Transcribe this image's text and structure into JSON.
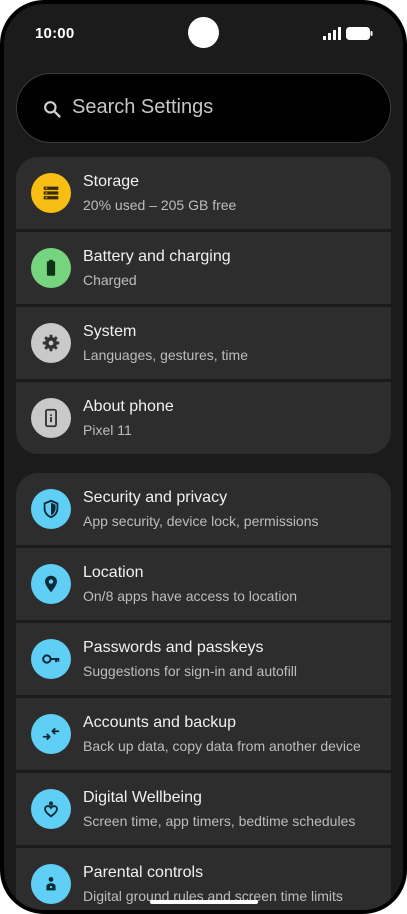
{
  "status_bar": {
    "time": "10:00",
    "icons": [
      "signal-icon",
      "battery-icon"
    ]
  },
  "search": {
    "placeholder": "Search Settings",
    "icon": "search-icon"
  },
  "groups": [
    {
      "items": [
        {
          "title": "Storage",
          "subtitle": "20% used – 205 GB free",
          "icon": "storage-icon",
          "color": "#f9be14"
        },
        {
          "title": "Battery and charging",
          "subtitle": "Charged",
          "icon": "battery-icon",
          "color": "#76d47e"
        },
        {
          "title": "System",
          "subtitle": "Languages, gestures, time",
          "icon": "gear-icon",
          "color": "#c9c9c9"
        },
        {
          "title": "About phone",
          "subtitle": "Pixel 11",
          "icon": "phone-info-icon",
          "color": "#c9c9c9"
        }
      ]
    },
    {
      "items": [
        {
          "title": "Security and privacy",
          "subtitle": "App security, device lock, permissions",
          "icon": "shield-icon",
          "color": "#5fcff5"
        },
        {
          "title": "Location",
          "subtitle": "On/8 apps have access to location",
          "icon": "location-pin-icon",
          "color": "#5fcff5"
        },
        {
          "title": "Passwords and passkeys",
          "subtitle": "Suggestions for sign-in and autofill",
          "icon": "key-icon",
          "color": "#5fcff5"
        },
        {
          "title": "Accounts and backup",
          "subtitle": "Back up data, copy data from another device",
          "icon": "sync-arrows-icon",
          "color": "#5fcff5"
        },
        {
          "title": "Digital Wellbeing",
          "subtitle": "Screen time, app timers, bedtime schedules",
          "icon": "wellbeing-heart-icon",
          "color": "#5fcff5"
        },
        {
          "title": "Parental controls",
          "subtitle": "Digital ground rules and screen time limits",
          "icon": "parental-controls-icon",
          "color": "#5fcff5"
        }
      ]
    }
  ]
}
